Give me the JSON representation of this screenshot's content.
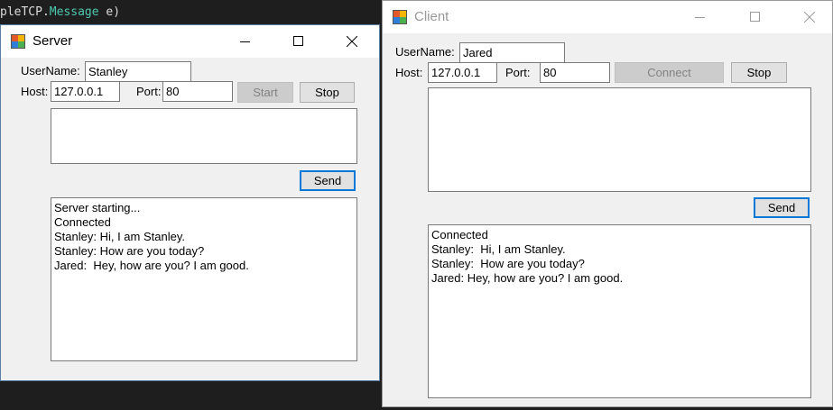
{
  "background_code": {
    "prefix": "pleTCP.",
    "member": "Message",
    "suffix": " e)"
  },
  "server": {
    "title": "Server",
    "username_label": "UserName:",
    "username_value": "Stanley",
    "host_label": "Host:",
    "host_value": "127.0.0.1",
    "port_label": "Port:",
    "port_value": "80",
    "start_label": "Start",
    "stop_label": "Stop",
    "message_value": "",
    "send_label": "Send",
    "log": [
      "Server starting...",
      "Connected",
      "Stanley: Hi, I am Stanley.",
      "Stanley: How are you today?",
      "Jared:  Hey, how are you? I am good."
    ]
  },
  "client": {
    "title": "Client",
    "username_label": "UserName:",
    "username_value": "Jared",
    "host_label": "Host:",
    "host_value": "127.0.0.1",
    "port_label": "Port:",
    "port_value": "80",
    "connect_label": "Connect",
    "stop_label": "Stop",
    "message_value": "",
    "send_label": "Send",
    "log": [
      "Connected",
      "Stanley:  Hi, I am Stanley.",
      "Stanley:  How are you today?",
      "Jared: Hey, how are you? I am good."
    ]
  },
  "icons": {
    "app": "winforms-app-icon",
    "minimize": "minimize-icon",
    "maximize": "maximize-icon",
    "close": "close-icon"
  },
  "colors": {
    "accent_focus": "#0078d7",
    "code_type": "#4ec9b0",
    "window_bg": "#f0f0f0"
  }
}
